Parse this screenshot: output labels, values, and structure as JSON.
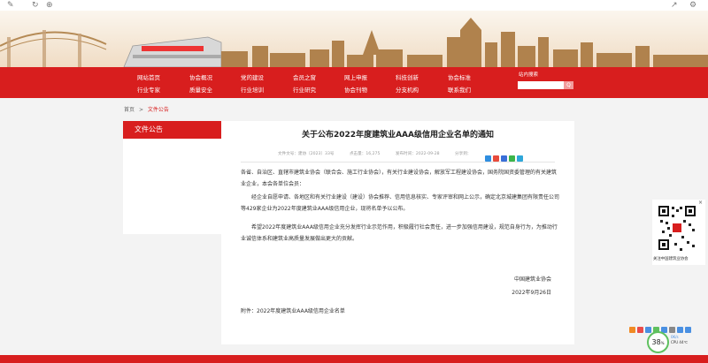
{
  "nav": {
    "row1": [
      "网站首页",
      "协会概况",
      "党的建设",
      "会员之窗",
      "网上申报",
      "科技创新",
      "协会标准"
    ],
    "row2": [
      "行业专家",
      "质量安全",
      "行业培训",
      "行业研究",
      "协会刊物",
      "分支机构",
      "联系我们"
    ],
    "search_label": "站内搜索",
    "search_button": "Q"
  },
  "breadcrumb": {
    "home": "首页",
    "separator": ">",
    "current": "文件公告"
  },
  "sidebar": {
    "title": "文件公告"
  },
  "article": {
    "title": "关于公布2022年度建筑业AAA级信用企业名单的通知",
    "meta": {
      "doc_no": "文件文号：建协〔2023〕33号",
      "views": "点击量：16,275",
      "date": "发布时间：2022-09-28",
      "share": "分享到："
    },
    "paragraphs": [
      "各省、自治区、直辖市建筑业协会（联合会、施工行业协会），有关行业建设协会，解放军工程建设协会，国务院国资委管理的有关建筑业企业，本会各单位会员：",
      "经企业自愿申请、各地区和有关行业建设（建设）协会推荐、信用信息核实、专家评审和网上公示，确定北京城建集团有限责任公司等429家企业为2022年度建筑业AAA级信用企业，现将名单予以公布。",
      "希望2022年度建筑业AAA级信用企业充分发挥行业示范作用，积极履行社会责任，进一步加强信用建设，规范自身行为，为推动行业诚信体系和建筑业高质量发展做出更大的贡献。"
    ],
    "signature_org": "中国建筑业协会",
    "signature_date": "2022年9月26日",
    "attachment": "附件：2022年度建筑业AAA级信用企业名单"
  },
  "qr": {
    "close": "×",
    "caption": "关注中国建筑业协会"
  },
  "speed_widget": {
    "percent": "38",
    "unit": "%",
    "label1": "0K/s",
    "label2": "CPU 44℃"
  },
  "icons": {
    "top_left": [
      "pencil-icon",
      "refresh-icon",
      "globe-icon"
    ],
    "top_right": [
      "share-icon",
      "settings-icon"
    ]
  },
  "colors": {
    "brand_red": "#d81e1e",
    "speed_green": "#5fc05f"
  }
}
